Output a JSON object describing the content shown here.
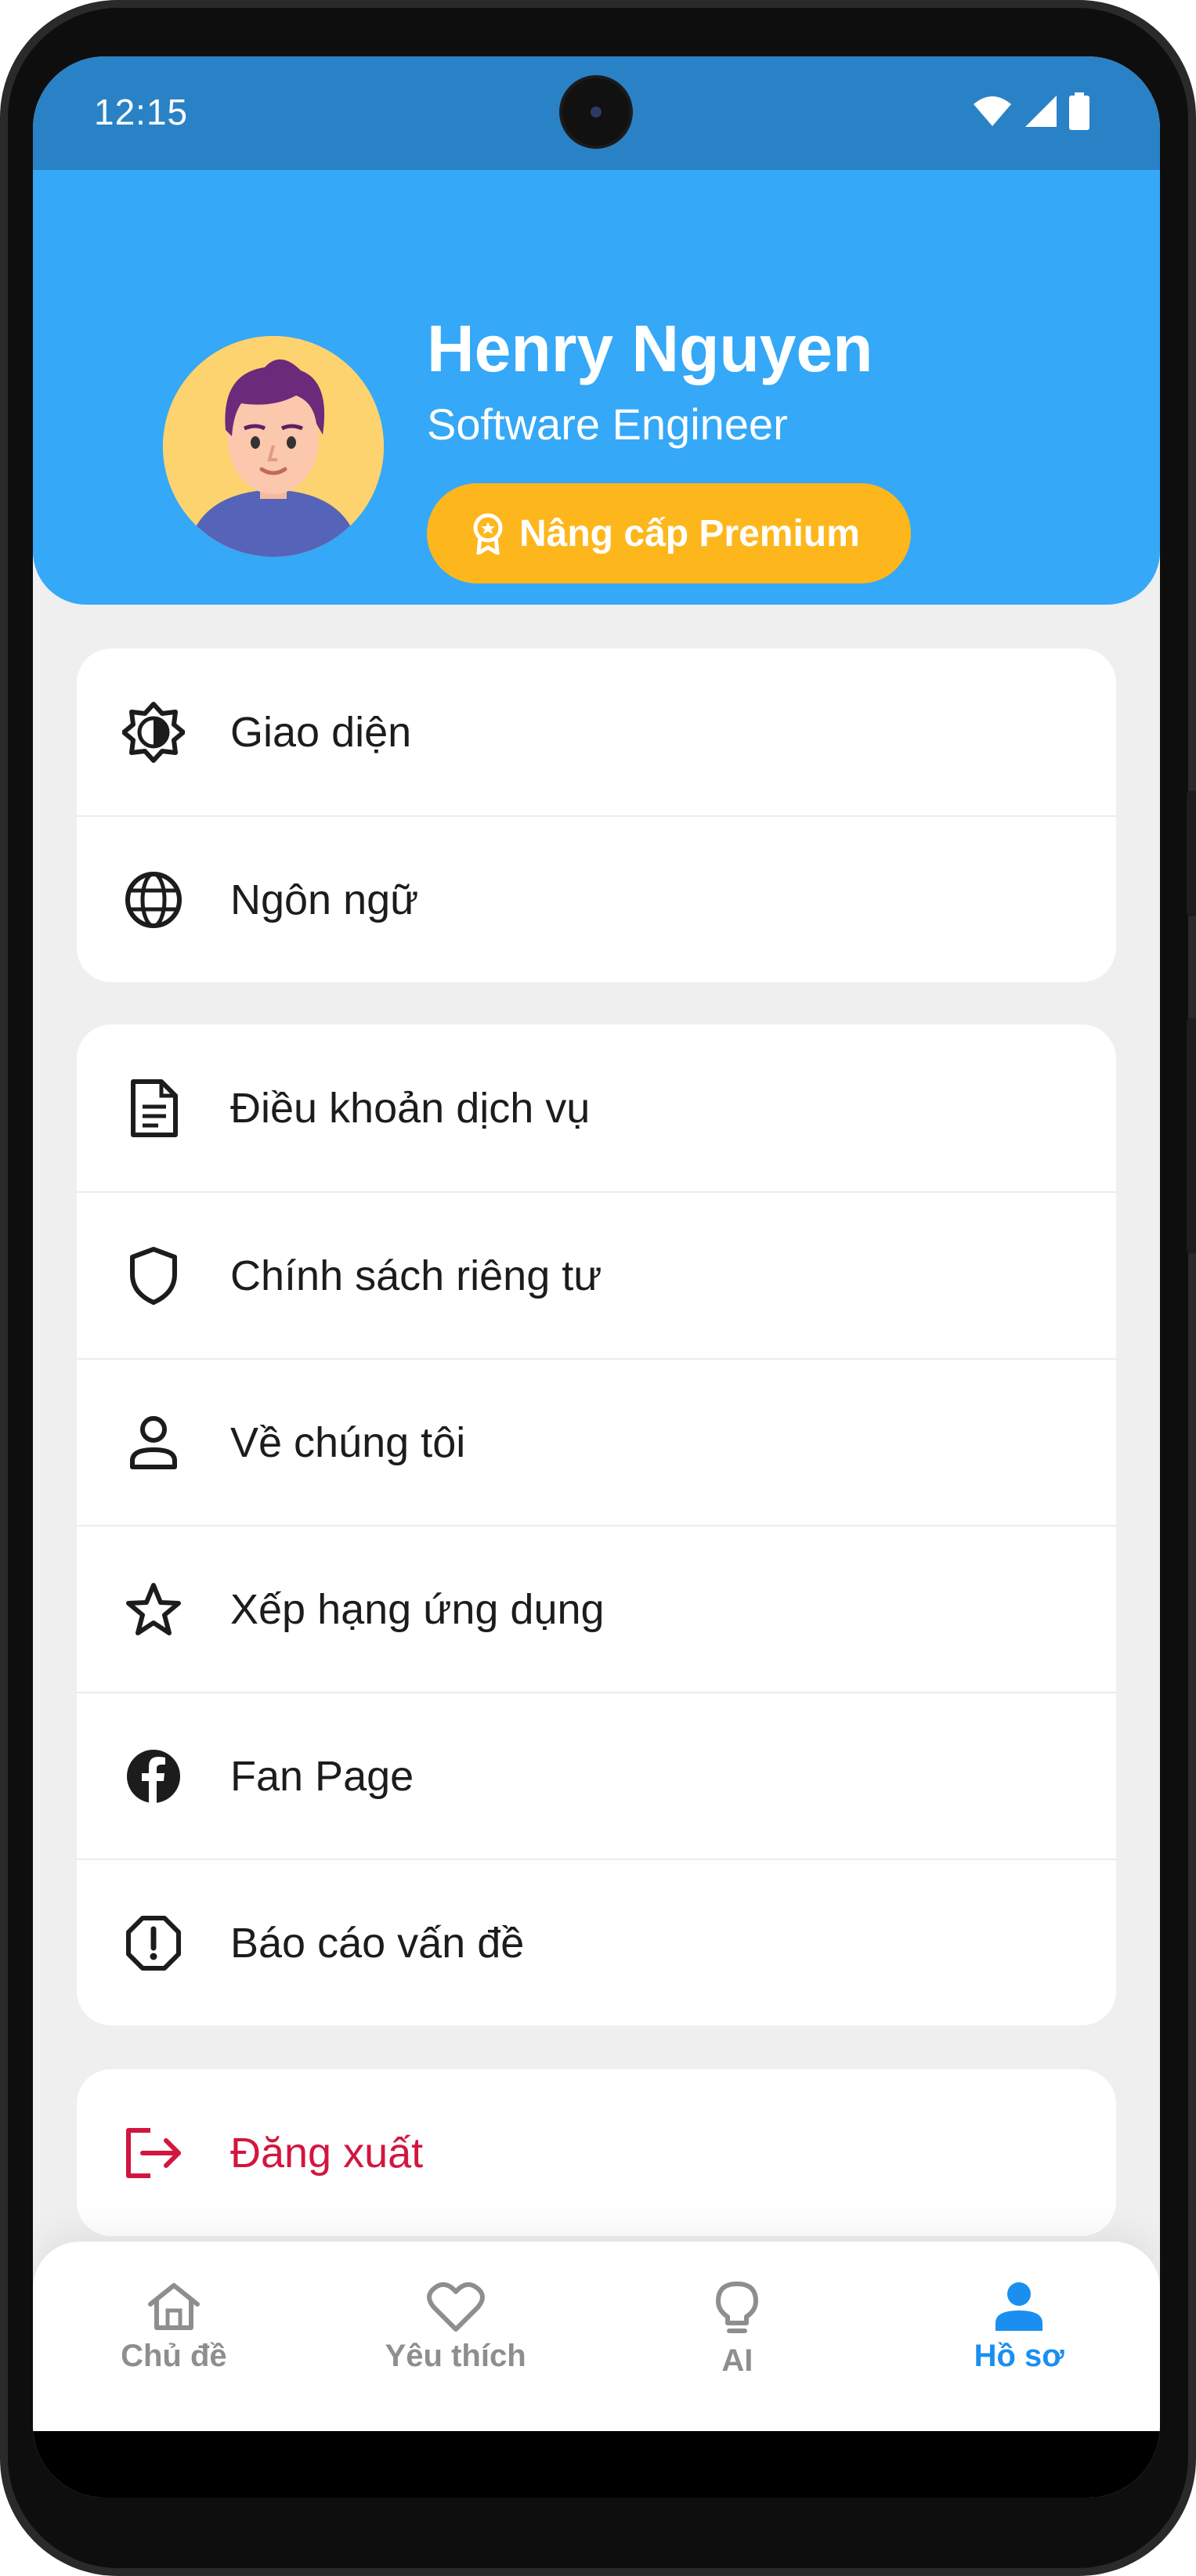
{
  "status_bar": {
    "time": "12:15"
  },
  "profile": {
    "name": "Henry Nguyen",
    "role": "Software Engineer",
    "premium_label": "Nâng cấp Premium"
  },
  "settings_group_1": [
    {
      "label": "Giao diện",
      "icon": "brightness-icon"
    },
    {
      "label": "Ngôn ngữ",
      "icon": "globe-icon"
    }
  ],
  "settings_group_2": [
    {
      "label": "Điều khoản dịch vụ",
      "icon": "document-icon"
    },
    {
      "label": "Chính sách riêng tư",
      "icon": "shield-icon"
    },
    {
      "label": "Về chúng tôi",
      "icon": "person-icon"
    },
    {
      "label": "Xếp hạng ứng dụng",
      "icon": "star-icon"
    },
    {
      "label": "Fan Page",
      "icon": "facebook-icon"
    },
    {
      "label": "Báo cáo vấn đề",
      "icon": "alert-icon"
    }
  ],
  "logout": {
    "label": "Đăng xuất",
    "icon": "logout-icon"
  },
  "bottom_nav": [
    {
      "label": "Chủ đề",
      "icon": "home-icon",
      "active": false
    },
    {
      "label": "Yêu thích",
      "icon": "heart-icon",
      "active": false
    },
    {
      "label": "AI",
      "icon": "lightbulb-icon",
      "active": false
    },
    {
      "label": "Hồ sơ",
      "icon": "profile-icon",
      "active": true
    }
  ],
  "colors": {
    "status_bar": "#2a82c6",
    "header": "#35a8f7",
    "premium": "#fdb71d",
    "logout": "#d2163f",
    "nav_active": "#1a8ff0",
    "nav_inactive": "#8e8e8e",
    "background": "#efefef"
  }
}
